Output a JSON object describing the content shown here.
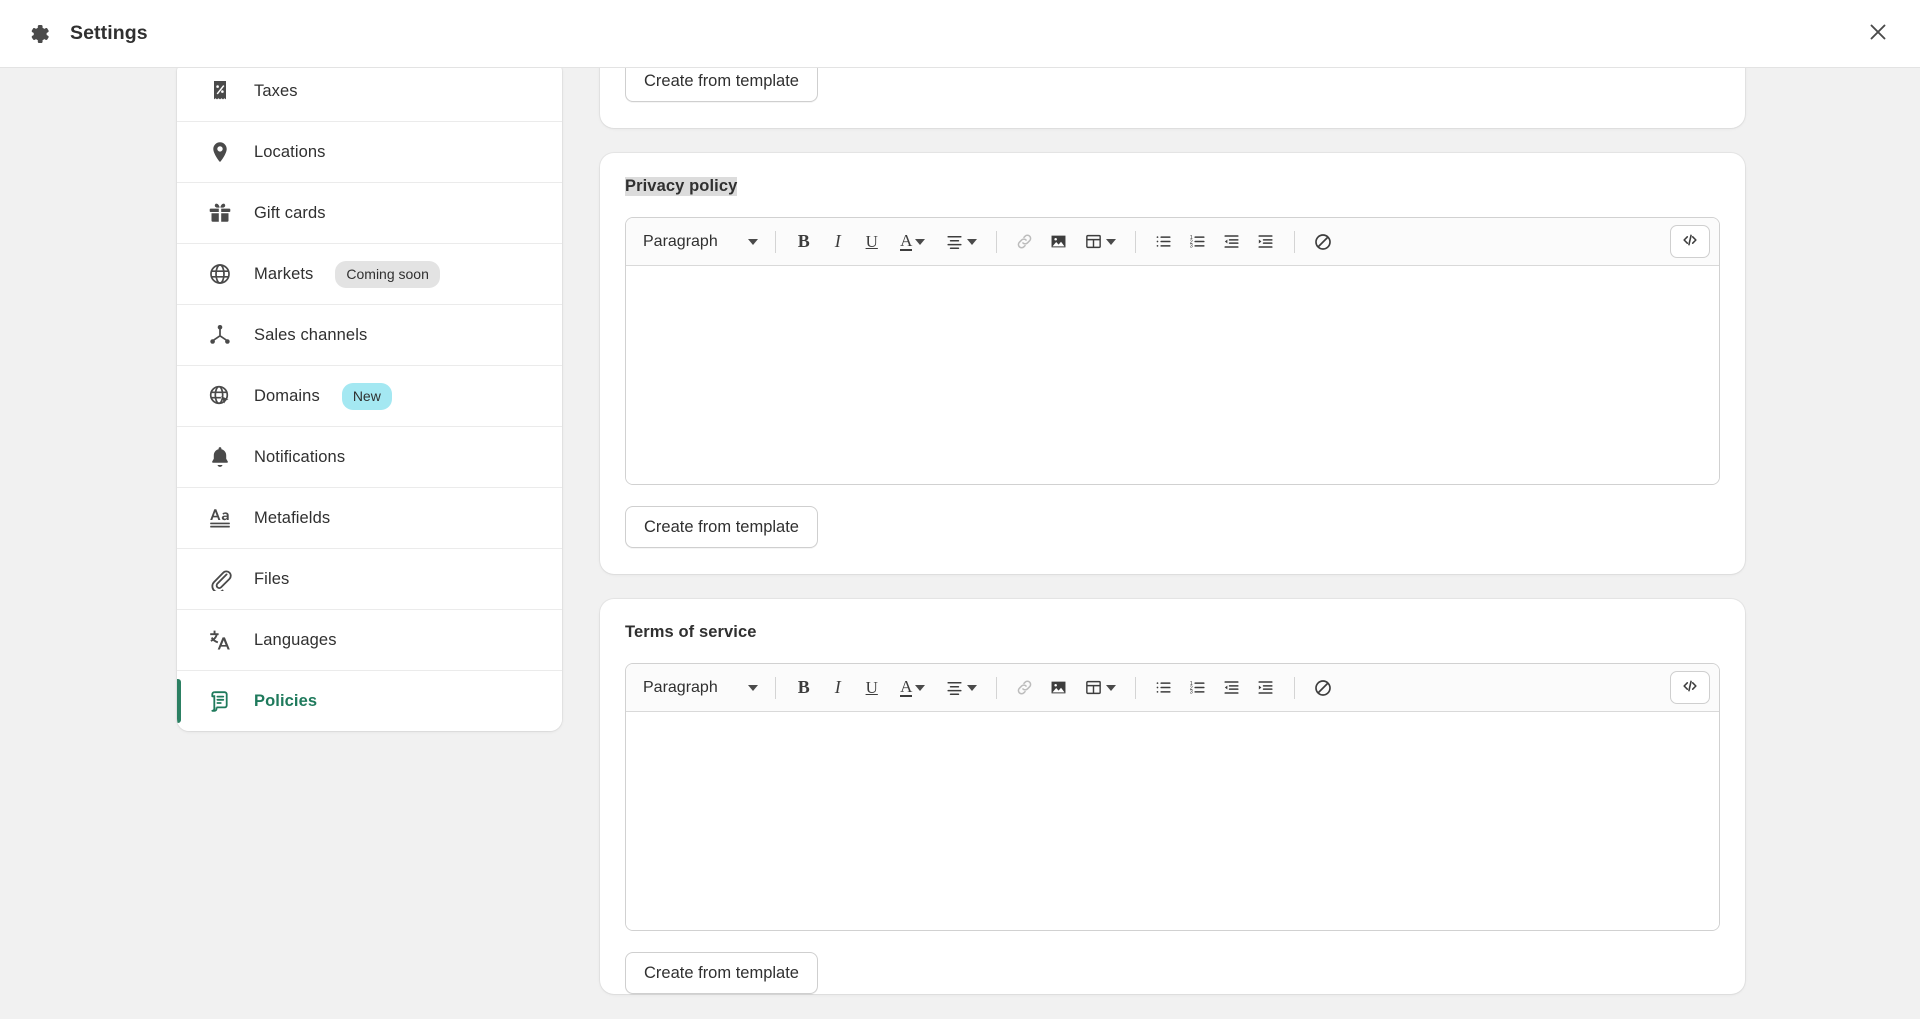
{
  "window": {
    "title": "Settings",
    "gear_icon": "gear-icon",
    "close_icon": "close-icon"
  },
  "sidebar": {
    "items": [
      {
        "label": "Taxes",
        "icon": "receipt-percent-icon",
        "badge": null,
        "selected": false
      },
      {
        "label": "Locations",
        "icon": "location-pin-icon",
        "badge": null,
        "selected": false
      },
      {
        "label": "Gift cards",
        "icon": "gift-icon",
        "badge": null,
        "selected": false
      },
      {
        "label": "Markets",
        "icon": "globe-icon",
        "badge": {
          "text": "Coming soon",
          "style": "gray"
        },
        "selected": false
      },
      {
        "label": "Sales channels",
        "icon": "channels-icon",
        "badge": null,
        "selected": false
      },
      {
        "label": "Domains",
        "icon": "globe-cursor-icon",
        "badge": {
          "text": "New",
          "style": "cyan"
        },
        "selected": false
      },
      {
        "label": "Notifications",
        "icon": "bell-icon",
        "badge": null,
        "selected": false
      },
      {
        "label": "Metafields",
        "icon": "text-aa-icon",
        "badge": null,
        "selected": false
      },
      {
        "label": "Files",
        "icon": "paperclip-icon",
        "badge": null,
        "selected": false
      },
      {
        "label": "Languages",
        "icon": "translate-icon",
        "badge": null,
        "selected": false
      },
      {
        "label": "Policies",
        "icon": "policy-scroll-icon",
        "badge": null,
        "selected": true
      }
    ]
  },
  "toolbar": {
    "block_format": "Paragraph",
    "buttons": [
      {
        "name": "bold-button",
        "glyph": "B",
        "disabled": false
      },
      {
        "name": "italic-button",
        "glyph": "I",
        "disabled": false
      },
      {
        "name": "underline-button",
        "glyph": "U",
        "disabled": false
      },
      {
        "name": "text-color-button",
        "glyph": "A",
        "disabled": false
      },
      {
        "name": "align-button",
        "glyph": "align",
        "disabled": false
      },
      {
        "name": "link-button",
        "glyph": "link",
        "disabled": true
      },
      {
        "name": "image-button",
        "glyph": "image",
        "disabled": false
      },
      {
        "name": "table-button",
        "glyph": "table",
        "disabled": false
      },
      {
        "name": "bulleted-list-button",
        "glyph": "ul",
        "disabled": false
      },
      {
        "name": "numbered-list-button",
        "glyph": "ol",
        "disabled": false
      },
      {
        "name": "outdent-button",
        "glyph": "outdent",
        "disabled": false
      },
      {
        "name": "indent-button",
        "glyph": "indent",
        "disabled": false
      },
      {
        "name": "clear-formatting-button",
        "glyph": "clear",
        "disabled": false
      }
    ],
    "code_view_label": "</>"
  },
  "main": {
    "sections": [
      {
        "title": "",
        "title_highlighted": false,
        "show_toolbar": false,
        "create_label": "Create from template"
      },
      {
        "title": "Privacy policy",
        "title_highlighted": true,
        "show_toolbar": true,
        "create_label": "Create from template"
      },
      {
        "title": "Terms of service",
        "title_highlighted": false,
        "show_toolbar": true,
        "create_label": "Create from template"
      }
    ]
  },
  "colors": {
    "accent": "#2c8063",
    "page_bg": "#f1f1f1",
    "card_bg": "#ffffff",
    "badge_new": "#a4e8f2",
    "badge_gray": "#e3e3e3",
    "selection_highlight": "#dcdcdc"
  }
}
